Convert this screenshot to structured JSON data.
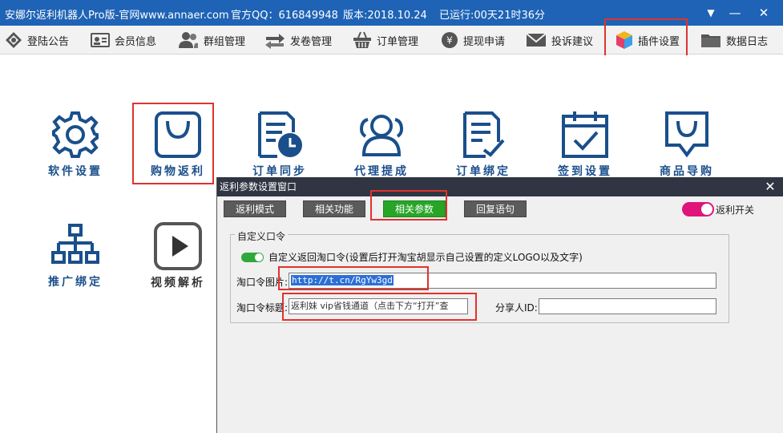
{
  "titlebar": {
    "app_title": "安娜尔返利机器人Pro版-官网www.annaer.com",
    "qq_label": "官方QQ：616849948",
    "version": "版本:2018.10.24",
    "runtime": "已运行:00天21时36分",
    "controls": {
      "dropdown": "▼",
      "minimize": "—",
      "close": "✕"
    }
  },
  "toolbar": {
    "items": [
      {
        "label": "登陆公告",
        "icon": "announcement-icon"
      },
      {
        "label": "会员信息",
        "icon": "member-card-icon"
      },
      {
        "label": "群组管理",
        "icon": "group-icon"
      },
      {
        "label": "发卷管理",
        "icon": "coupon-arrows-icon"
      },
      {
        "label": "订单管理",
        "icon": "basket-icon"
      },
      {
        "label": "提现申请",
        "icon": "yen-coin-icon"
      },
      {
        "label": "投诉建议",
        "icon": "envelope-icon"
      },
      {
        "label": "插件设置",
        "icon": "cube-icon"
      },
      {
        "label": "数据日志",
        "icon": "folder-icon"
      }
    ]
  },
  "tiles": [
    {
      "label": "软件设置",
      "icon": "gear-icon"
    },
    {
      "label": "购物返利",
      "icon": "shopping-bag-icon"
    },
    {
      "label": "订单同步",
      "icon": "document-clock-icon"
    },
    {
      "label": "代理提成",
      "icon": "users-icon"
    },
    {
      "label": "订单绑定",
      "icon": "checklist-icon"
    },
    {
      "label": "签到设置",
      "icon": "calendar-check-icon"
    },
    {
      "label": "商品导购",
      "icon": "chat-bag-icon"
    },
    {
      "label": "推广绑定",
      "icon": "hierarchy-icon"
    },
    {
      "label": "视频解析",
      "icon": "play-icon"
    }
  ],
  "dialog": {
    "title": "返利参数设置窗口",
    "close": "✕",
    "tabs": [
      "返利模式",
      "相关功能",
      "相关参数",
      "回复语句"
    ],
    "active_tab": "相关参数",
    "rebate_switch_label": "返利开关",
    "rebate_switch_on": true,
    "group_title": "自定义口令",
    "custom_switch_label": "自定义返回淘口令(设置后打开淘宝胡显示自己设置的定义LOGO以及文字)",
    "custom_switch_on": true,
    "image_label": "淘口令图片:",
    "image_value": "http://t.cn/RgYw3gd",
    "caption_label": "淘口令标题:",
    "caption_value": "返利妹 vip省钱通道（点击下方“打开”查",
    "sharer_label": "分享人ID:",
    "sharer_value": ""
  },
  "colors": {
    "titlebar_bg": "#1e63b5",
    "icon_blue": "#1a4f8b",
    "highlight_red": "#e0322e",
    "active_tab_green": "#27a527",
    "switch_pink": "#e0137b",
    "switch_green": "#2fa83b"
  }
}
